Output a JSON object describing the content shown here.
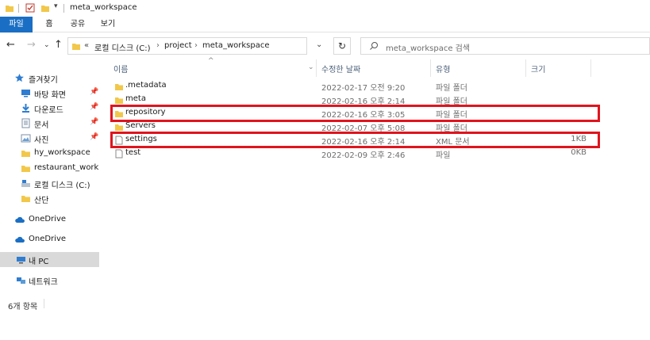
{
  "window": {
    "title": "meta_workspace"
  },
  "ribbon": {
    "tabs": [
      "파일",
      "홈",
      "공유",
      "보기"
    ]
  },
  "address": {
    "overflow": "«",
    "crumbs": [
      "로컬 디스크 (C:)",
      "project",
      "meta_workspace"
    ],
    "separator": "›"
  },
  "search": {
    "placeholder": "meta_workspace 검색"
  },
  "sidebar": {
    "items": [
      {
        "label": "즐겨찾기",
        "icon": "star-icon"
      },
      {
        "label": "바탕 화면",
        "icon": "desktop-icon",
        "pinned": true
      },
      {
        "label": "다운로드",
        "icon": "download-icon",
        "pinned": true
      },
      {
        "label": "문서",
        "icon": "document-icon",
        "pinned": true
      },
      {
        "label": "사진",
        "icon": "pictures-icon",
        "pinned": true
      },
      {
        "label": "hy_workspace",
        "icon": "folder-icon"
      },
      {
        "label": "restaurant_workspace",
        "icon": "folder-icon"
      },
      {
        "label": "로컬 디스크 (C:)",
        "icon": "drive-icon"
      },
      {
        "label": "산단",
        "icon": "folder-icon"
      },
      {
        "label": "OneDrive",
        "icon": "cloud-icon"
      },
      {
        "label": "OneDrive",
        "icon": "cloud-icon"
      },
      {
        "label": "내 PC",
        "icon": "computer-icon",
        "selected": true
      },
      {
        "label": "네트워크",
        "icon": "network-icon"
      }
    ]
  },
  "columns": [
    "이름",
    "수정한 날짜",
    "유형",
    "크기"
  ],
  "files": [
    {
      "name": ".metadata",
      "date": "2022-02-17 오전 9:20",
      "type": "파일 폴더",
      "size": "",
      "kind": "folder",
      "highlighted": false
    },
    {
      "name": "meta",
      "date": "2022-02-16 오후 2:14",
      "type": "파일 폴더",
      "size": "",
      "kind": "folder",
      "highlighted": false
    },
    {
      "name": "repository",
      "date": "2022-02-16 오후 3:05",
      "type": "파일 폴더",
      "size": "",
      "kind": "folder",
      "highlighted": true
    },
    {
      "name": "Servers",
      "date": "2022-02-07 오후 5:08",
      "type": "파일 폴더",
      "size": "",
      "kind": "folder",
      "highlighted": false
    },
    {
      "name": "settings",
      "date": "2022-02-16 오후 2:14",
      "type": "XML 문서",
      "size": "1KB",
      "kind": "file",
      "highlighted": true
    },
    {
      "name": "test",
      "date": "2022-02-09 오후 2:46",
      "type": "파일",
      "size": "0KB",
      "kind": "file",
      "highlighted": false
    }
  ],
  "status": {
    "count": "6개 항목"
  },
  "colors": {
    "accent": "#1a6fc4",
    "highlight": "#e0141e",
    "folder": "#f2c84b",
    "selected": "#d9d9d9"
  }
}
